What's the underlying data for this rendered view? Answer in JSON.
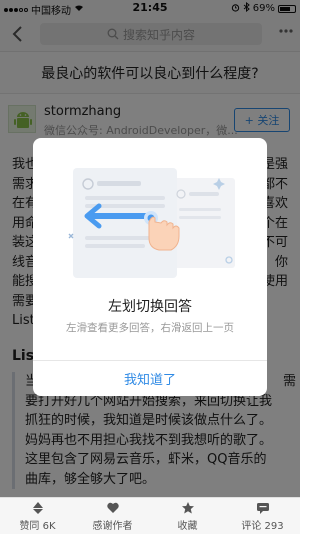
{
  "status_bar": {
    "carrier": "中国移动",
    "time": "21:45",
    "battery_percent": "69%"
  },
  "topbar": {
    "search_placeholder": "搜索知乎内容"
  },
  "question": {
    "title": "最良心的软件可以良心到什么程度?"
  },
  "author": {
    "name": "stormzhang",
    "subtitle": "微信公众号: AndroidDeveloper，微...",
    "follow_label": "+ 关注"
  },
  "answer": {
    "lines_left": [
      "我也",
      "需求",
      "在有",
      "用命",
      "装这",
      "线音",
      "能搜",
      "需要",
      "List"
    ],
    "lines_right": [
      "是强",
      "都不",
      "喜欢",
      "个在",
      "不可",
      "你",
      "使用"
    ],
    "subhead": "List",
    "quote_lines": [
      "当",
      "要打开好几个网站开始搜索，来回切换让我",
      "抓狂的时候，我知道是时候该做点什么了。",
      "妈妈再也不用担心我找不到我想听的歌了。",
      "这里包含了网易云音乐，虾米，QQ音乐的",
      "曲库，够全够大了吧。"
    ],
    "quote_tail": "需"
  },
  "dialog": {
    "title": "左划切换回答",
    "subtitle": "左滑查看更多回答，右滑返回上一页",
    "button_label": "我知道了"
  },
  "bottom_bar": {
    "items": [
      {
        "label": "赞同 6K",
        "icon": "upvote-icon"
      },
      {
        "label": "感谢作者",
        "icon": "heart-icon"
      },
      {
        "label": "收藏",
        "icon": "star-icon"
      },
      {
        "label": "评论 293",
        "icon": "comment-icon"
      }
    ]
  },
  "colors": {
    "accent": "#2f8ae5",
    "overlay": "rgba(0,0,0,0.5)"
  }
}
